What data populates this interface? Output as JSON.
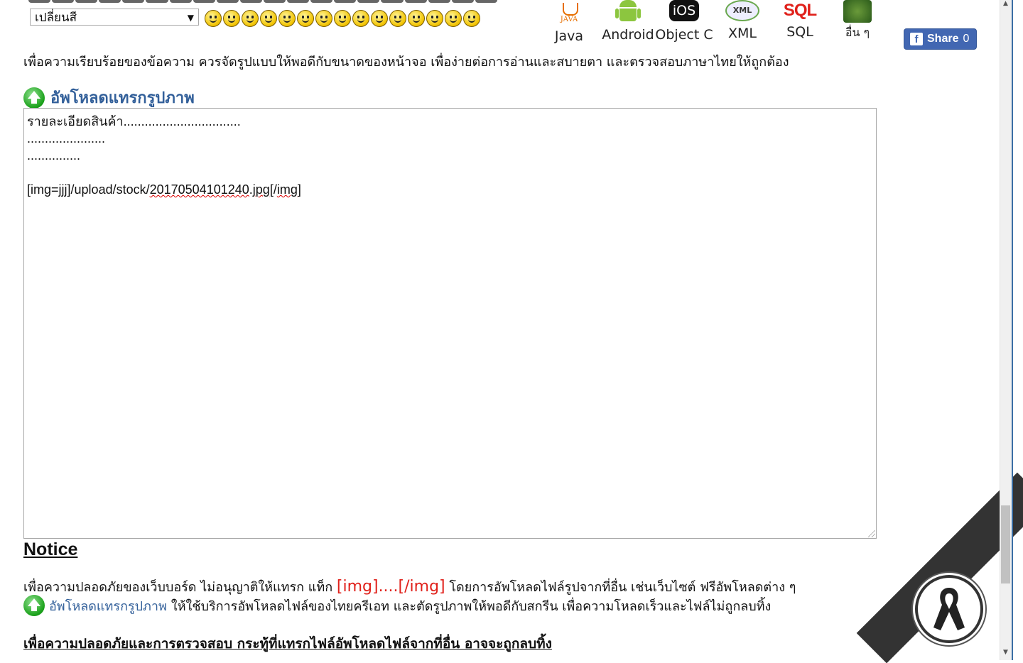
{
  "toolbar": {
    "color_select_value": "เปลี่ยนสี",
    "smiley_count": 15
  },
  "languages": [
    {
      "label": "Java",
      "icon": "java-icon"
    },
    {
      "label": "Android",
      "icon": "android-icon"
    },
    {
      "label": "Object C",
      "icon": "ios-icon",
      "badge": "iOS"
    },
    {
      "label": "XML",
      "icon": "xml-icon",
      "badge": "XML"
    },
    {
      "label": "SQL",
      "icon": "sql-icon",
      "badge": "SQL"
    },
    {
      "label": "อื่น ๆ",
      "icon": "other-icon"
    }
  ],
  "share": {
    "label": "Share",
    "count": "0"
  },
  "info_text": "เพื่อความเรียบร้อยของข้อความ ควรจัดรูปแบบให้พอดีกับขนาดของหน้าจอ เพื่อง่ายต่อการอ่านและสบายตา และตรวจสอบภาษาไทยให้ถูกต้อง",
  "upload": {
    "heading": "อัพโหลดแทรกรูปภาพ"
  },
  "editor": {
    "line1": "รายละเอียดสินค้า.................................",
    "line2": "......................",
    "line3": "...............",
    "line4_a": "[img=",
    "line4_b": "jjj",
    "line4_c": "]/upload/stock/",
    "line4_d": "20170504101240",
    "line4_e": ".",
    "line4_f": "jpg",
    "line4_g": "[/",
    "line4_h": "img",
    "line4_i": "]"
  },
  "notice": {
    "title": "Notice",
    "line1_a": "เพื่อความปลอดภัยของเว็บบอร์ด ไม่อนุญาติให้แทรก แท็ก ",
    "line1_tag": "[img]....[/img]",
    "line1_b": " โดยการอัพโหลดไฟล์รูปจากที่อื่น เช่นเว็บไซต์ ฟรีอัพโหลดต่าง ๆ",
    "line2_link": "อัพโหลดแทรกรูปภาพ",
    "line2_b": " ให้ใช้บริการอัพโหลดไฟล์ของไทยครีเอท และตัดรูปภาพให้พอดีกับสกรีน เพื่อความโหลดเร็วและไฟล์ไม่ถูกลบทิ้ง",
    "warning": "เพื่อความปลอดภัยและการตรวจสอบ กระทู้ที่แทรกไฟล์อัพโหลดไฟล์จากที่อื่น อาจจะถูกลบทิ้ง"
  },
  "colors": {
    "link": "#33609a",
    "red": "#e0201a",
    "facebook": "#4267b2"
  }
}
